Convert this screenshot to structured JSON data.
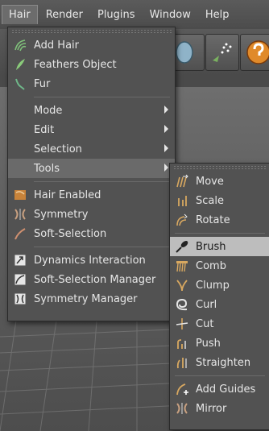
{
  "menubar": {
    "items": [
      "Hair",
      "Render",
      "Plugins",
      "Window",
      "Help"
    ]
  },
  "hair_menu": {
    "items": [
      {
        "label": "Add Hair",
        "icon": "add-hair-icon"
      },
      {
        "label": "Feathers Object",
        "icon": "feather-icon"
      },
      {
        "label": "Fur",
        "icon": "fur-icon"
      },
      {
        "label": "Mode",
        "submenu": true
      },
      {
        "label": "Edit",
        "submenu": true
      },
      {
        "label": "Selection",
        "submenu": true
      },
      {
        "label": "Tools",
        "submenu": true
      },
      {
        "label": "Hair Enabled",
        "icon": "hair-enabled-icon"
      },
      {
        "label": "Symmetry",
        "icon": "symmetry-icon"
      },
      {
        "label": "Soft-Selection",
        "icon": "soft-selection-icon"
      },
      {
        "label": "Dynamics Interaction",
        "icon": "dynamics-interaction-icon"
      },
      {
        "label": "Soft-Selection Manager",
        "icon": "soft-selection-manager-icon"
      },
      {
        "label": "Symmetry Manager",
        "icon": "symmetry-manager-icon"
      }
    ]
  },
  "tools_submenu": {
    "items": [
      {
        "label": "Move",
        "icon": "move-icon"
      },
      {
        "label": "Scale",
        "icon": "scale-icon"
      },
      {
        "label": "Rotate",
        "icon": "rotate-icon"
      },
      {
        "label": "Brush",
        "icon": "brush-icon"
      },
      {
        "label": "Comb",
        "icon": "comb-icon"
      },
      {
        "label": "Clump",
        "icon": "clump-icon"
      },
      {
        "label": "Curl",
        "icon": "curl-icon"
      },
      {
        "label": "Cut",
        "icon": "cut-icon"
      },
      {
        "label": "Push",
        "icon": "push-icon"
      },
      {
        "label": "Straighten",
        "icon": "straighten-icon"
      },
      {
        "label": "Add Guides",
        "icon": "add-guides-icon"
      },
      {
        "label": "Mirror",
        "icon": "mirror-icon"
      }
    ]
  },
  "colors": {
    "menu_bg": "#525252",
    "highlight": "#6a6a6a",
    "hover_highlight": "#bdbdbd"
  }
}
